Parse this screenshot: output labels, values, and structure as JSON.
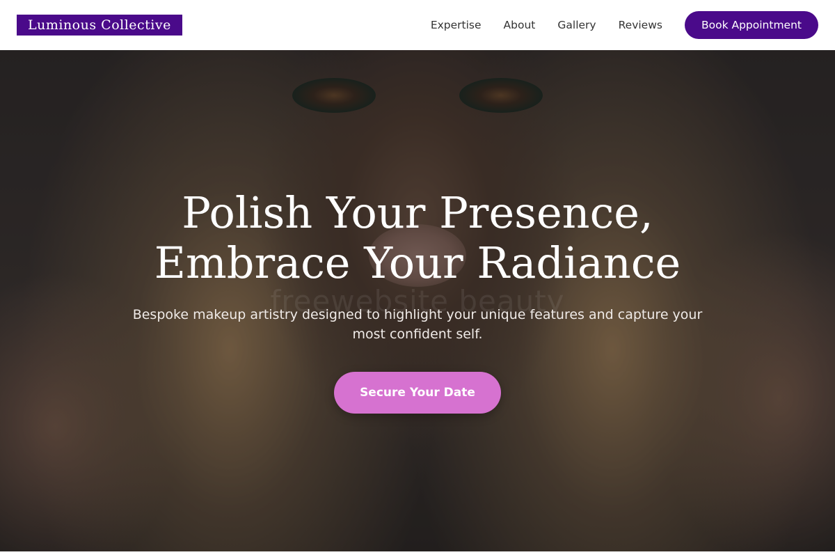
{
  "brand": {
    "name": "Luminous Collective",
    "accent": "#4a0a8a",
    "cta_color": "#d672d0"
  },
  "nav": {
    "links": [
      "Expertise",
      "About",
      "Gallery",
      "Reviews"
    ],
    "cta_label": "Book Appointment"
  },
  "hero": {
    "title_line1": "Polish Your Presence,",
    "title_line2": "Embrace Your Radiance",
    "subtitle": "Bespoke makeup artistry designed to highlight your unique features and capture your most confident self.",
    "cta_label": "Secure Your Date",
    "watermark": "freewebsite beauty"
  }
}
